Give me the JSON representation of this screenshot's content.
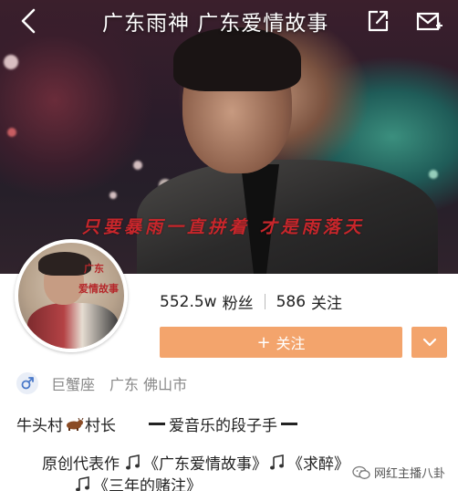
{
  "header": {
    "title": "广东雨神   广东爱情故事",
    "icons": [
      "back-icon",
      "share-icon",
      "mail-icon"
    ]
  },
  "banner": {
    "caption": "只要暴雨一直拼着  才是雨落天"
  },
  "avatar": {
    "text1": "广东",
    "text2": "爱情故事"
  },
  "stats": {
    "fans_value": "552.5w",
    "fans_label": "粉丝",
    "follow_value": "586",
    "follow_label": "关注"
  },
  "actions": {
    "follow_label": "关注",
    "follow_icon": "plus-icon",
    "dropdown_icon": "chevron-down-icon",
    "accent_color": "#f3a46c"
  },
  "meta": {
    "gender_icon": "male-icon",
    "zodiac": "巨蟹座",
    "location": "广东 佛山市"
  },
  "bio": {
    "line1_part1": "牛头村",
    "line1_part2": "村长",
    "line1_tagline": "爱音乐的段子手",
    "line2_prefix": "原创代表作",
    "line2_song1": "《广东爱情故事》",
    "line2_song2": "《求醉》",
    "line3_song3": "《三年的赌注》"
  },
  "watermark": {
    "text": "网红主播八卦"
  }
}
